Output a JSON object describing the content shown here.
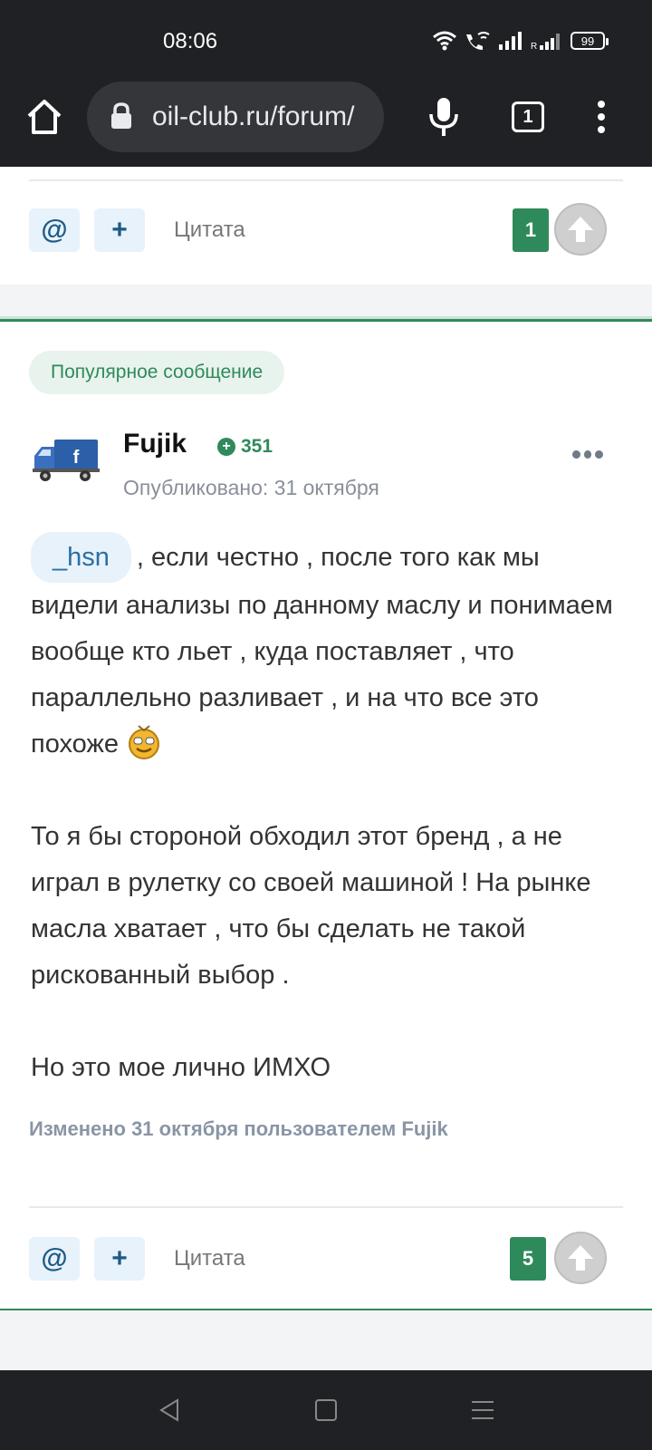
{
  "status_bar": {
    "time": "08:06",
    "battery": "99"
  },
  "browser": {
    "url": "oil-club.ru/forum/",
    "tab_count": "1"
  },
  "prev_post": {
    "quote_label": "Цитата",
    "reputation": "1"
  },
  "post": {
    "badge": "Популярное сообщение",
    "author": "Fujik",
    "author_reputation": "351",
    "posted": "Опубликовано: 31 октября",
    "mention": "_hsn",
    "paragraphs": [
      ", если честно , после того как мы видели анализы по данному маслу и понимаем вообще кто льет , куда поставляет , что параллельно разливает , и на что все это похоже",
      "То я бы стороной обходил этот бренд , а не играл в рулетку со своей машиной ! На рынке масла хватает  , что бы сделать не такой рискованный выбор .",
      "Но это мое лично ИМХО"
    ],
    "edited": "Изменено 31 октября пользователем Fujik",
    "quote_label": "Цитата",
    "reputation": "5"
  },
  "icons": {
    "mention_button": "@",
    "add_button": "+"
  }
}
